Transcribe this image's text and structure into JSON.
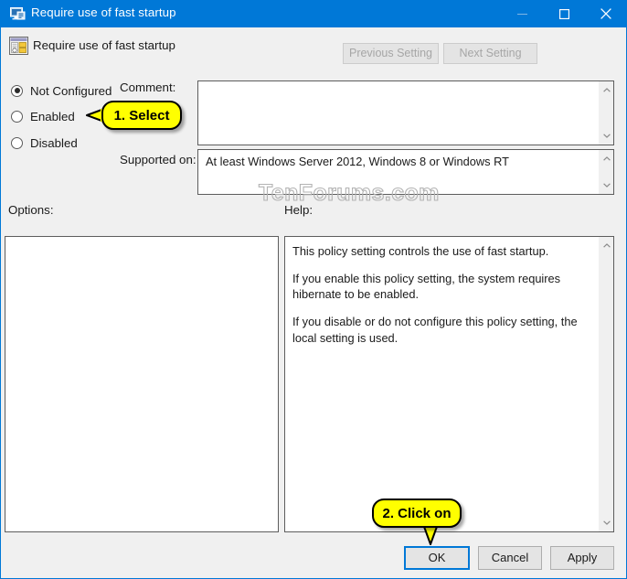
{
  "window": {
    "title": "Require use of fast startup",
    "title_icon": "policy-monitor-icon",
    "controls": {
      "minimize": "minimize-icon",
      "maximize": "maximize-icon",
      "close": "close-icon"
    }
  },
  "header": {
    "icon": "policy-setting-icon",
    "title": "Require use of fast startup",
    "previous_setting": "Previous Setting",
    "next_setting": "Next Setting"
  },
  "state_options": [
    {
      "label": "Not Configured",
      "selected": true
    },
    {
      "label": "Enabled",
      "selected": false
    },
    {
      "label": "Disabled",
      "selected": false
    }
  ],
  "comment": {
    "label": "Comment:",
    "value": ""
  },
  "supported_on": {
    "label": "Supported on:",
    "value": "At least Windows Server 2012, Windows 8 or Windows RT"
  },
  "options": {
    "label": "Options:",
    "value": ""
  },
  "help": {
    "label": "Help:",
    "paragraphs": [
      "This policy setting controls the use of fast startup.",
      "If you enable this policy setting, the system requires hibernate to be enabled.",
      "If you disable or do not configure this policy setting, the local setting is used."
    ]
  },
  "watermark": "TenForums.com",
  "buttons": {
    "ok": "OK",
    "cancel": "Cancel",
    "apply": "Apply"
  },
  "annotations": [
    {
      "text": "1. Select"
    },
    {
      "text": "2. Click on"
    }
  ],
  "colors": {
    "titlebar": "#0078d7",
    "accent": "#0078d7",
    "dialog_background": "#f0f0f0",
    "callout_fill": "#ffff00",
    "field_background": "#ffffff"
  }
}
